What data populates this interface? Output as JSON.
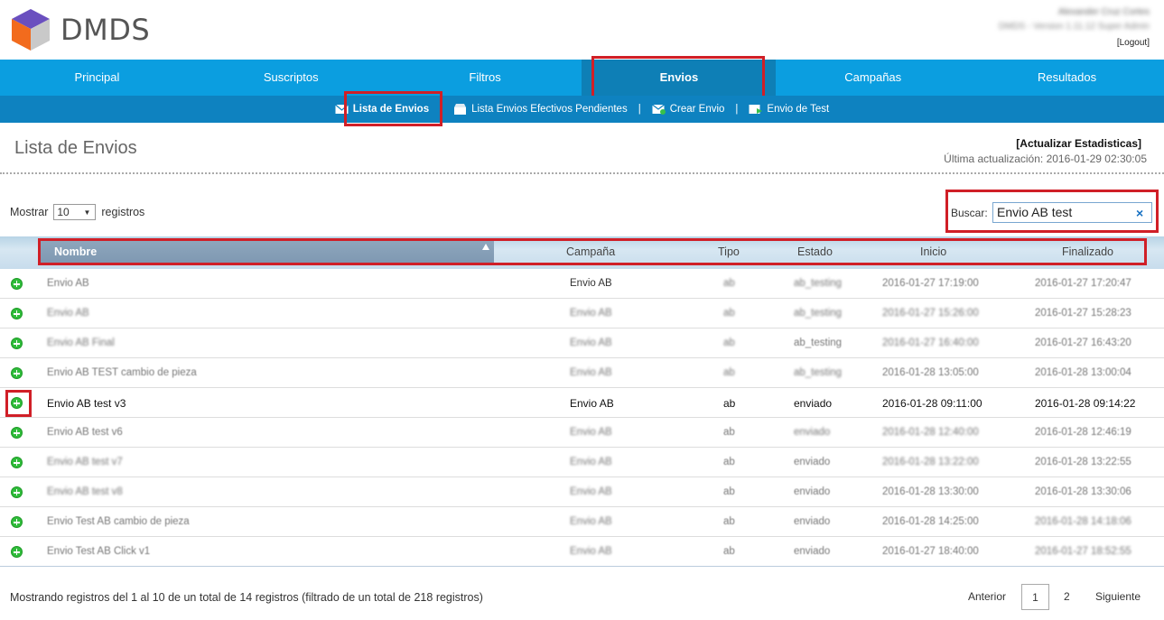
{
  "app": {
    "name": "DMDS"
  },
  "user": {
    "name": "Alexander Cruz Cortes",
    "version": "DMDS - Version 1.11.12 Super Admin",
    "logout_label": "[Logout]"
  },
  "mainnav": [
    "Principal",
    "Suscriptos",
    "Filtros",
    "Envios",
    "Campañas",
    "Resultados"
  ],
  "mainnav_active": "Envios",
  "subnav": {
    "lista": "Lista de Envios",
    "pendientes": "Lista Envios Efectivos Pendientes",
    "crear": "Crear Envio",
    "test": "Envio de Test",
    "separator": "|"
  },
  "page": {
    "title": "Lista de Envios",
    "refresh_label": "[Actualizar Estadisticas]",
    "last_update_label": "Última actualización:",
    "last_update_value": "2016-01-29 02:30:05"
  },
  "controls": {
    "show_label": "Mostrar",
    "show_value": "10",
    "show_suffix": "registros",
    "search_label": "Buscar:",
    "search_value": "Envio AB test",
    "clear_glyph": "×"
  },
  "table": {
    "columns": [
      "Nombre",
      "Campaña",
      "Tipo",
      "Estado",
      "Inicio",
      "Finalizado"
    ],
    "sorted_column": "Nombre",
    "rows": [
      {
        "nombre": "Envio AB",
        "campana": "Envio AB",
        "tipo": "ab",
        "estado": "ab_testing",
        "inicio": "2016-01-27 17:19:00",
        "fin": "2016-01-27 17:20:47"
      },
      {
        "nombre": "Envio AB",
        "campana": "Envio AB",
        "tipo": "ab",
        "estado": "ab_testing",
        "inicio": "2016-01-27 15:26:00",
        "fin": "2016-01-27 15:28:23"
      },
      {
        "nombre": "Envio AB Final",
        "campana": "Envio AB",
        "tipo": "ab",
        "estado": "ab_testing",
        "inicio": "2016-01-27 16:40:00",
        "fin": "2016-01-27 16:43:20"
      },
      {
        "nombre": "Envio AB TEST cambio de pieza",
        "campana": "Envio AB",
        "tipo": "ab",
        "estado": "ab_testing",
        "inicio": "2016-01-28 13:05:00",
        "fin": "2016-01-28 13:00:04"
      },
      {
        "nombre": "Envio AB test v3",
        "campana": "Envio AB",
        "tipo": "ab",
        "estado": "enviado",
        "inicio": "2016-01-28 09:11:00",
        "fin": "2016-01-28 09:14:22"
      },
      {
        "nombre": "Envio AB test v6",
        "campana": "Envio AB",
        "tipo": "ab",
        "estado": "enviado",
        "inicio": "2016-01-28 12:40:00",
        "fin": "2016-01-28 12:46:19"
      },
      {
        "nombre": "Envio AB test v7",
        "campana": "Envio AB",
        "tipo": "ab",
        "estado": "enviado",
        "inicio": "2016-01-28 13:22:00",
        "fin": "2016-01-28 13:22:55"
      },
      {
        "nombre": "Envio AB test v8",
        "campana": "Envio AB",
        "tipo": "ab",
        "estado": "enviado",
        "inicio": "2016-01-28 13:30:00",
        "fin": "2016-01-28 13:30:06"
      },
      {
        "nombre": "Envio Test AB cambio de pieza",
        "campana": "Envio AB",
        "tipo": "ab",
        "estado": "enviado",
        "inicio": "2016-01-28 14:25:00",
        "fin": "2016-01-28 14:18:06"
      },
      {
        "nombre": "Envio Test AB Click v1",
        "campana": "Envio AB",
        "tipo": "ab",
        "estado": "enviado",
        "inicio": "2016-01-27 18:40:00",
        "fin": "2016-01-27 18:52:55"
      }
    ]
  },
  "footer": {
    "info": "Mostrando registros del 1 al 10 de un total de 14 registros (filtrado de un total de 218 registros)",
    "prev": "Anterior",
    "page1": "1",
    "page2": "2",
    "next": "Siguiente"
  }
}
